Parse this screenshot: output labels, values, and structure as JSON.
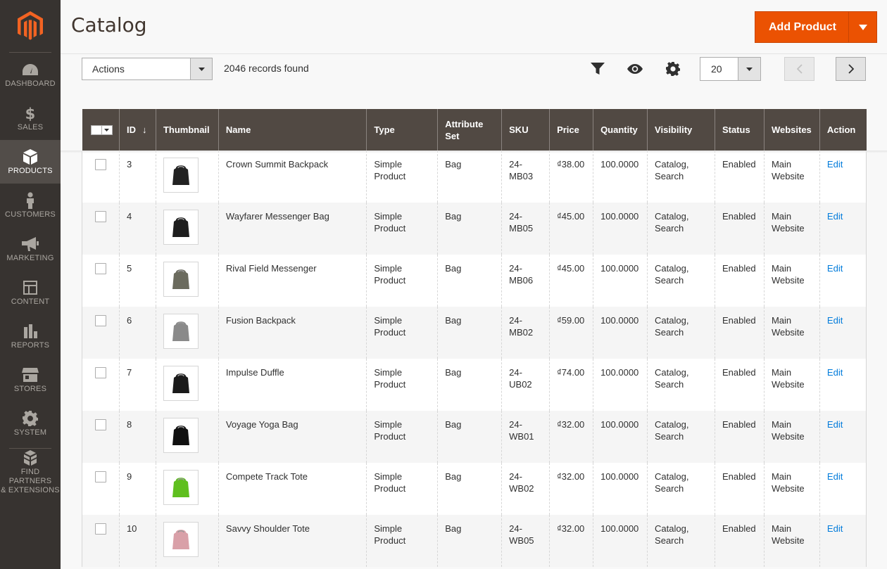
{
  "nav": {
    "items": [
      {
        "label": "DASHBOARD",
        "icon": "dashboard-icon"
      },
      {
        "label": "SALES",
        "icon": "dollar-icon"
      },
      {
        "label": "PRODUCTS",
        "icon": "box-icon",
        "active": true
      },
      {
        "label": "CUSTOMERS",
        "icon": "person-icon"
      },
      {
        "label": "MARKETING",
        "icon": "megaphone-icon"
      },
      {
        "label": "CONTENT",
        "icon": "layout-icon"
      },
      {
        "label": "REPORTS",
        "icon": "bar-chart-icon"
      },
      {
        "label": "STORES",
        "icon": "store-icon"
      },
      {
        "label": "SYSTEM",
        "icon": "gear-icon"
      }
    ],
    "partners_line1": "FIND PARTNERS",
    "partners_line2": "& EXTENSIONS"
  },
  "header": {
    "title": "Catalog",
    "add_button": "Add Product"
  },
  "toolbar": {
    "actions": "Actions",
    "records": "2046 records found",
    "per_page": "20"
  },
  "grid": {
    "columns": [
      "ID",
      "Thumbnail",
      "Name",
      "Type",
      "Attribute Set",
      "SKU",
      "Price",
      "Quantity",
      "Visibility",
      "Status",
      "Websites",
      "Action"
    ],
    "sort_indicator": "↓",
    "rows": [
      {
        "id": "3",
        "name": "Crown Summit Backpack",
        "type": "Simple Product",
        "attr": "Bag",
        "sku": "24-MB03",
        "price": "₫38.00",
        "qty": "100.0000",
        "visibility": "Catalog, Search",
        "status": "Enabled",
        "websites": "Main Website",
        "action": "Edit",
        "thumb_color": "#222222"
      },
      {
        "id": "4",
        "name": "Wayfarer Messenger Bag",
        "type": "Simple Product",
        "attr": "Bag",
        "sku": "24-MB05",
        "price": "₫45.00",
        "qty": "100.0000",
        "visibility": "Catalog, Search",
        "status": "Enabled",
        "websites": "Main Website",
        "action": "Edit",
        "thumb_color": "#1e1e1e"
      },
      {
        "id": "5",
        "name": "Rival Field Messenger",
        "type": "Simple Product",
        "attr": "Bag",
        "sku": "24-MB06",
        "price": "₫45.00",
        "qty": "100.0000",
        "visibility": "Catalog, Search",
        "status": "Enabled",
        "websites": "Main Website",
        "action": "Edit",
        "thumb_color": "#6b6b5e"
      },
      {
        "id": "6",
        "name": "Fusion Backpack",
        "type": "Simple Product",
        "attr": "Bag",
        "sku": "24-MB02",
        "price": "₫59.00",
        "qty": "100.0000",
        "visibility": "Catalog, Search",
        "status": "Enabled",
        "websites": "Main Website",
        "action": "Edit",
        "thumb_color": "#8a8a8a"
      },
      {
        "id": "7",
        "name": "Impulse Duffle",
        "type": "Simple Product",
        "attr": "Bag",
        "sku": "24-UB02",
        "price": "₫74.00",
        "qty": "100.0000",
        "visibility": "Catalog, Search",
        "status": "Enabled",
        "websites": "Main Website",
        "action": "Edit",
        "thumb_color": "#1a1a1a"
      },
      {
        "id": "8",
        "name": "Voyage Yoga Bag",
        "type": "Simple Product",
        "attr": "Bag",
        "sku": "24-WB01",
        "price": "₫32.00",
        "qty": "100.0000",
        "visibility": "Catalog, Search",
        "status": "Enabled",
        "websites": "Main Website",
        "action": "Edit",
        "thumb_color": "#111111"
      },
      {
        "id": "9",
        "name": "Compete Track Tote",
        "type": "Simple Product",
        "attr": "Bag",
        "sku": "24-WB02",
        "price": "₫32.00",
        "qty": "100.0000",
        "visibility": "Catalog, Search",
        "status": "Enabled",
        "websites": "Main Website",
        "action": "Edit",
        "thumb_color": "#5fbf1e"
      },
      {
        "id": "10",
        "name": "Savvy Shoulder Tote",
        "type": "Simple Product",
        "attr": "Bag",
        "sku": "24-WB05",
        "price": "₫32.00",
        "qty": "100.0000",
        "visibility": "Catalog, Search",
        "status": "Enabled",
        "websites": "Main Website",
        "action": "Edit",
        "thumb_color": "#d9a0a8"
      }
    ]
  },
  "colors": {
    "accent": "#eb5202",
    "sidebar": "#373330",
    "table_header": "#514943",
    "link": "#007bdb"
  }
}
